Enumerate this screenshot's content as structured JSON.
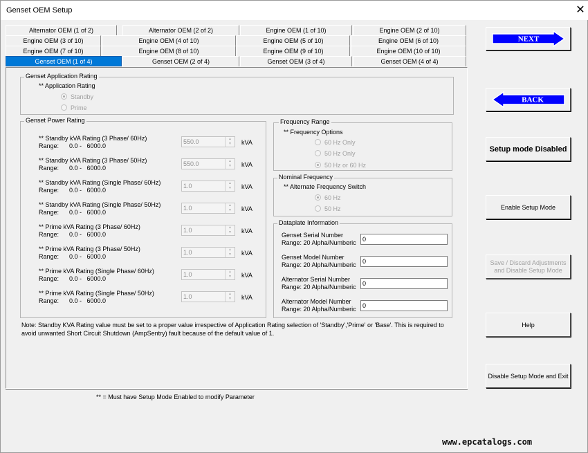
{
  "window": {
    "title": "Genset OEM Setup"
  },
  "tabs": {
    "row1": [
      "Alternator OEM (1 of 2)",
      "Alternator OEM (2 of 2)",
      "Engine OEM (1 of 10)",
      "Engine OEM (2 of 10)"
    ],
    "row2": [
      "Engine OEM (3 of 10)",
      "Engine OEM (4 of 10)",
      "Engine OEM (5 of 10)",
      "Engine OEM (6 of 10)"
    ],
    "row3": [
      "Engine OEM (7 of 10)",
      "Engine OEM (8 of 10)",
      "Engine OEM (9 of 10)",
      "Engine OEM (10 of 10)"
    ],
    "row4": [
      "Genset OEM (1 of 4)",
      "Genset OEM (2 of 4)",
      "Genset OEM (3 of 4)",
      "Genset OEM (4 of 4)"
    ],
    "active": "Genset OEM (1 of 4)"
  },
  "application_rating": {
    "group_title": "Genset Application Rating",
    "label": "** Application Rating",
    "options": [
      "Standby",
      "Prime"
    ],
    "selected": "Standby"
  },
  "power_rating": {
    "group_title": "Genset Power Rating",
    "unit": "kVA",
    "rows": [
      {
        "label": "** Standby kVA Rating (3 Phase/ 60Hz)",
        "range": "Range:      0.0 -   6000.0",
        "value": "550.0"
      },
      {
        "label": "** Standby kVA Rating (3 Phase/ 50Hz)",
        "range": "Range:      0.0 -   6000.0",
        "value": "550.0"
      },
      {
        "label": "** Standby kVA Rating (Single Phase/ 60Hz)",
        "range": "Range:      0.0 -   6000.0",
        "value": "1.0"
      },
      {
        "label": "** Standby kVA Rating (Single Phase/ 50Hz)",
        "range": "Range:      0.0 -   6000.0",
        "value": "1.0"
      },
      {
        "label": "** Prime kVA Rating (3 Phase/ 60Hz)",
        "range": "Range:      0.0 -   6000.0",
        "value": "1.0"
      },
      {
        "label": "** Prime kVA Rating (3 Phase/ 50Hz)",
        "range": "Range:      0.0 -   6000.0",
        "value": "1.0"
      },
      {
        "label": "** Prime kVA Rating (Single Phase/ 60Hz)",
        "range": "Range:      0.0 -   6000.0",
        "value": "1.0"
      },
      {
        "label": "** Prime kVA Rating (Single Phase/ 50Hz)",
        "range": "Range:      0.0 -   6000.0",
        "value": "1.0"
      }
    ]
  },
  "frequency_range": {
    "group_title": "Frequency Range",
    "label": "** Frequency Options",
    "options": [
      "60 Hz Only",
      "50 Hz Only",
      "50 Hz or 60 Hz"
    ],
    "selected": "50 Hz or 60 Hz"
  },
  "nominal_frequency": {
    "group_title": "Nominal Frequency",
    "label": "** Alternate Frequency Switch",
    "options": [
      "60 Hz",
      "50 Hz"
    ],
    "selected": "60 Hz"
  },
  "dataplate": {
    "group_title": "Dataplate Information",
    "fields": [
      {
        "label": "Genset Serial Number",
        "range": "Range: 20 Alpha/Numberic",
        "value": "0"
      },
      {
        "label": "Genset Model Number",
        "range": "Range: 20 Alpha/Numberic",
        "value": "0"
      },
      {
        "label": "Alternator Serial Number",
        "range": "Range: 20 Alpha/Numberic",
        "value": "0"
      },
      {
        "label": "Alternator Model Number",
        "range": "Range: 20 Alpha/Numberic",
        "value": "0"
      }
    ]
  },
  "note": {
    "line1": "Note: Standby KVA Rating value must be set to a proper value irrespective of Application Rating selection of 'Standby','Prime'  or 'Base'. This is required to",
    "line2": "avoid unwanted Short Circuit Shutdown (AmpSentry) fault because of the default value of 1."
  },
  "footer": "** = Must have Setup Mode Enabled to modify Parameter",
  "buttons": {
    "next": "NEXT",
    "back": "BACK",
    "setup_status": "Setup mode Disabled",
    "enable_setup": "Enable Setup Mode",
    "save_discard": "Save / Discard Adjustments and Disable Setup Mode",
    "help": "Help",
    "disable_exit": "Disable Setup Mode and Exit"
  },
  "watermark": "www.epcatalogs.com",
  "colors": {
    "active_tab": "#0078d7",
    "arrow_blue": "#0000ff",
    "arrow_border": "#ffffff"
  }
}
